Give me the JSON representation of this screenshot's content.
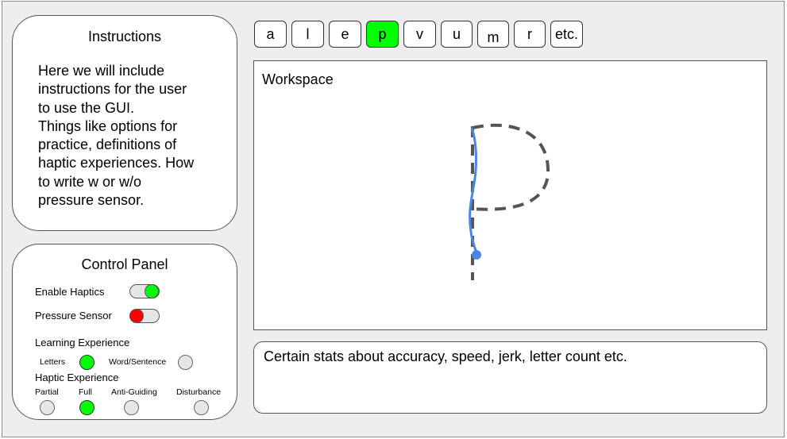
{
  "instructions": {
    "title": "Instructions",
    "lines": [
      "Here we will include",
      "instructions for the user",
      "to use the GUI.",
      "Things like options for",
      "practice, definitions of",
      "haptic experiences. How",
      "to write w or w/o",
      "pressure sensor."
    ]
  },
  "control_panel": {
    "title": "Control Panel",
    "enable_haptics": {
      "label": "Enable Haptics",
      "state": "on",
      "color": "#00ff00"
    },
    "pressure_sensor": {
      "label": "Pressure Sensor",
      "state": "off",
      "color": "#ff0000"
    },
    "learning_experience": {
      "label": "Learning Experience",
      "options": [
        {
          "label": "Letters",
          "selected": true
        },
        {
          "label": "Word/Sentence",
          "selected": false
        }
      ]
    },
    "haptic_experience": {
      "label": "Haptic Experience",
      "options": [
        {
          "label": "Partial",
          "selected": false
        },
        {
          "label": "Full",
          "selected": true
        },
        {
          "label": "Anti-Guiding",
          "selected": false
        },
        {
          "label": "Disturbance",
          "selected": false
        }
      ]
    }
  },
  "letter_buttons": [
    {
      "label": "a",
      "selected": false
    },
    {
      "label": "l",
      "selected": false
    },
    {
      "label": "e",
      "selected": false
    },
    {
      "label": "p",
      "selected": true
    },
    {
      "label": "v",
      "selected": false
    },
    {
      "label": "u",
      "selected": false
    },
    {
      "label": "m",
      "selected": false
    },
    {
      "label": "r",
      "selected": false
    },
    {
      "label": "etc.",
      "selected": false
    }
  ],
  "workspace": {
    "title": "Workspace",
    "guide_letter": "p"
  },
  "stats": {
    "text": "Certain stats about accuracy, speed, jerk, letter count etc."
  },
  "colors": {
    "selected_green": "#00ff00",
    "off_red": "#ff0000",
    "trace_blue": "#4a86e8",
    "guide_gray": "#555555"
  }
}
